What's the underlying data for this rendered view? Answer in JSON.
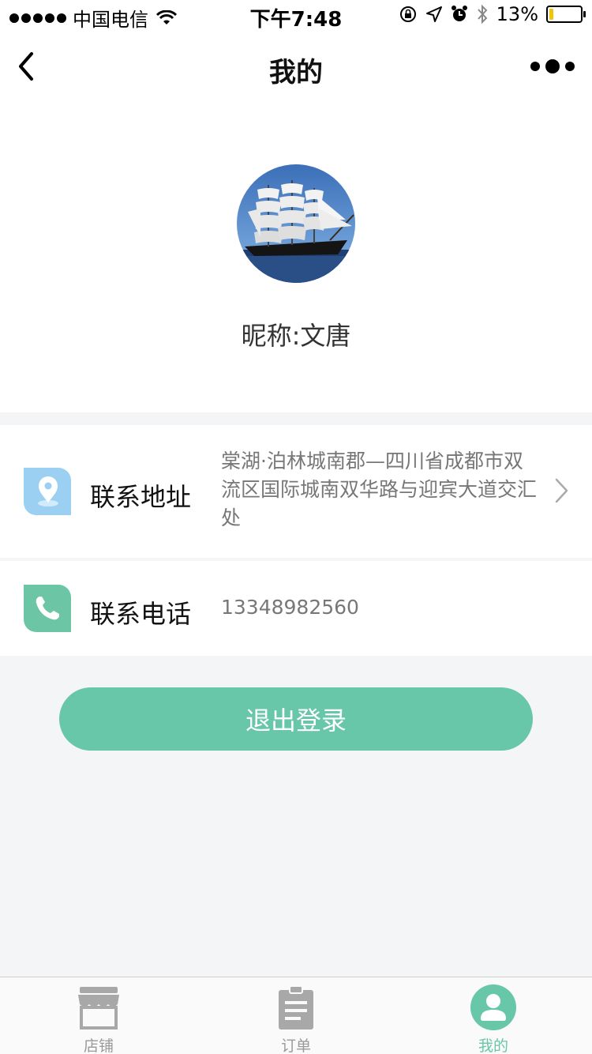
{
  "status_bar": {
    "carrier": "中国电信",
    "time": "下午7:48",
    "battery": "13%",
    "battery_level": 0.13
  },
  "nav": {
    "title": "我的",
    "back_icon": "chevron-left-icon",
    "more_icon": "more-dots-icon"
  },
  "profile": {
    "avatar": "sailing-ship-avatar",
    "nickname": "昵称:文唐"
  },
  "address": {
    "label": "联系地址",
    "value": "棠湖·泊林城南郡—四川省成都市双流区国际城南双华路与迎宾大道交汇处",
    "icon": "location-pin-icon",
    "icon_color": "#9bd0f2"
  },
  "phone": {
    "label": "联系电话",
    "value": "13348982560",
    "icon": "phone-icon",
    "icon_color": "#6cc6a5"
  },
  "logout": {
    "label": "退出登录",
    "color": "#68c6a9"
  },
  "tabs": [
    {
      "label": "店铺",
      "icon": "store-icon",
      "active": false
    },
    {
      "label": "订单",
      "icon": "clipboard-icon",
      "active": false
    },
    {
      "label": "我的",
      "icon": "user-icon",
      "active": true
    }
  ]
}
